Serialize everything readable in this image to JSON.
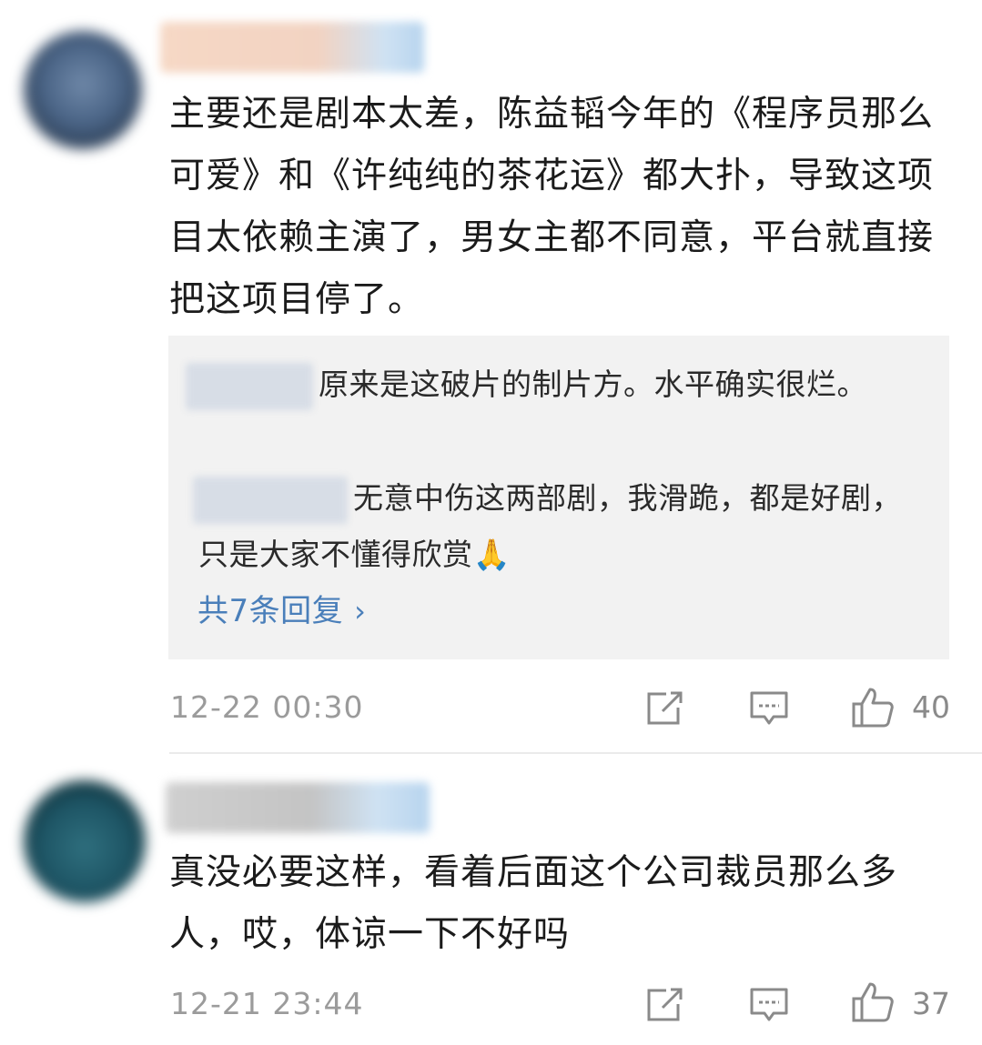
{
  "comments": [
    {
      "text": "主要还是剧本太差，陈益韬今年的《程序员那么可爱》和《许纯纯的茶花运》都大扑，导致这项目太依赖主演了，男女主都不同意，平台就直接把这项目停了。",
      "replies": [
        {
          "text": "原来是这破片的制片方。水平确实很烂。"
        },
        {
          "text": "无意中伤这两部剧，我滑跪，都是好剧，只是大家不懂得欣赏🙏"
        }
      ],
      "more_replies": "共7条回复",
      "timestamp": "12-22 00:30",
      "likes": "40"
    },
    {
      "text": "真没必要这样，看着后面这个公司裁员那么多人，哎，体谅一下不好吗",
      "timestamp": "12-21 23:44",
      "likes": "37"
    }
  ],
  "icons": {
    "share": "share-icon",
    "comment": "comment-icon",
    "like": "thumbs-up-icon"
  },
  "colors": {
    "link": "#4a7fba",
    "reply_bg": "#f2f2f2",
    "meta": "#9b9b9b"
  }
}
